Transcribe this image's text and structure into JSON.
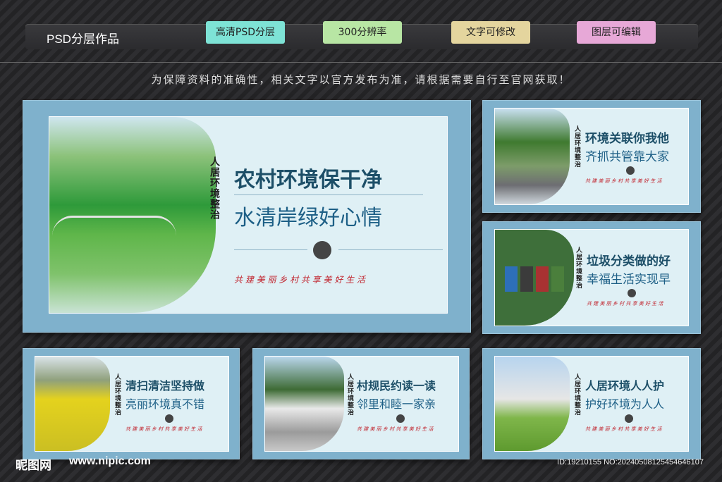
{
  "header": {
    "title": "PSD分层作品",
    "tags": [
      {
        "label": "高清PSD分层",
        "color": "#7ee3d6"
      },
      {
        "label": "300分辨率",
        "color": "#b8e6a4"
      },
      {
        "label": "文字可修改",
        "color": "#e4d59e"
      },
      {
        "label": "图层可编辑",
        "color": "#e7a8d7"
      }
    ]
  },
  "notice": "为保障资料的准确性，相关文字以官方发布为准，请根据需要自行至官网获取！",
  "main_board": {
    "vertical": "人居环境整治",
    "headline": "农村环境保干净",
    "subline": "水清岸绿好心情",
    "slogan": "共 建 美 丽 乡 村    共 享 美 好 生 活"
  },
  "boards": [
    {
      "headline": "环境关联你我他",
      "subline": "齐抓共管靠大家",
      "slogan": "共 建 美 丽 乡 村   共 享 美 好 生 活",
      "vertical": "人居环境整治"
    },
    {
      "headline": "垃圾分类做的好",
      "subline": "幸福生活实现早",
      "slogan": "共 建 美 丽 乡 村   共 享 美 好 生 活",
      "vertical": "人居环境整治"
    },
    {
      "headline": "清扫清洁坚持做",
      "subline": "亮丽环境真不错",
      "slogan": "共 建 美 丽 乡 村   共 享 美 好 生 活",
      "vertical": "人居环境整治"
    },
    {
      "headline": "村规民约读一读",
      "subline": "邻里和睦一家亲",
      "slogan": "共 建 美 丽 乡 村   共 享 美 好 生 活",
      "vertical": "人居环境整治"
    },
    {
      "headline": "人居环境人人护",
      "subline": "护好环境为人人",
      "slogan": "共 建 美 丽 乡 村   共 享 美 好 生 活",
      "vertical": "人居环境整治"
    }
  ],
  "footer": {
    "logo": "昵图网",
    "url": "www.nipic.com",
    "id": "ID:19210155 NO:20240508125454646107"
  }
}
